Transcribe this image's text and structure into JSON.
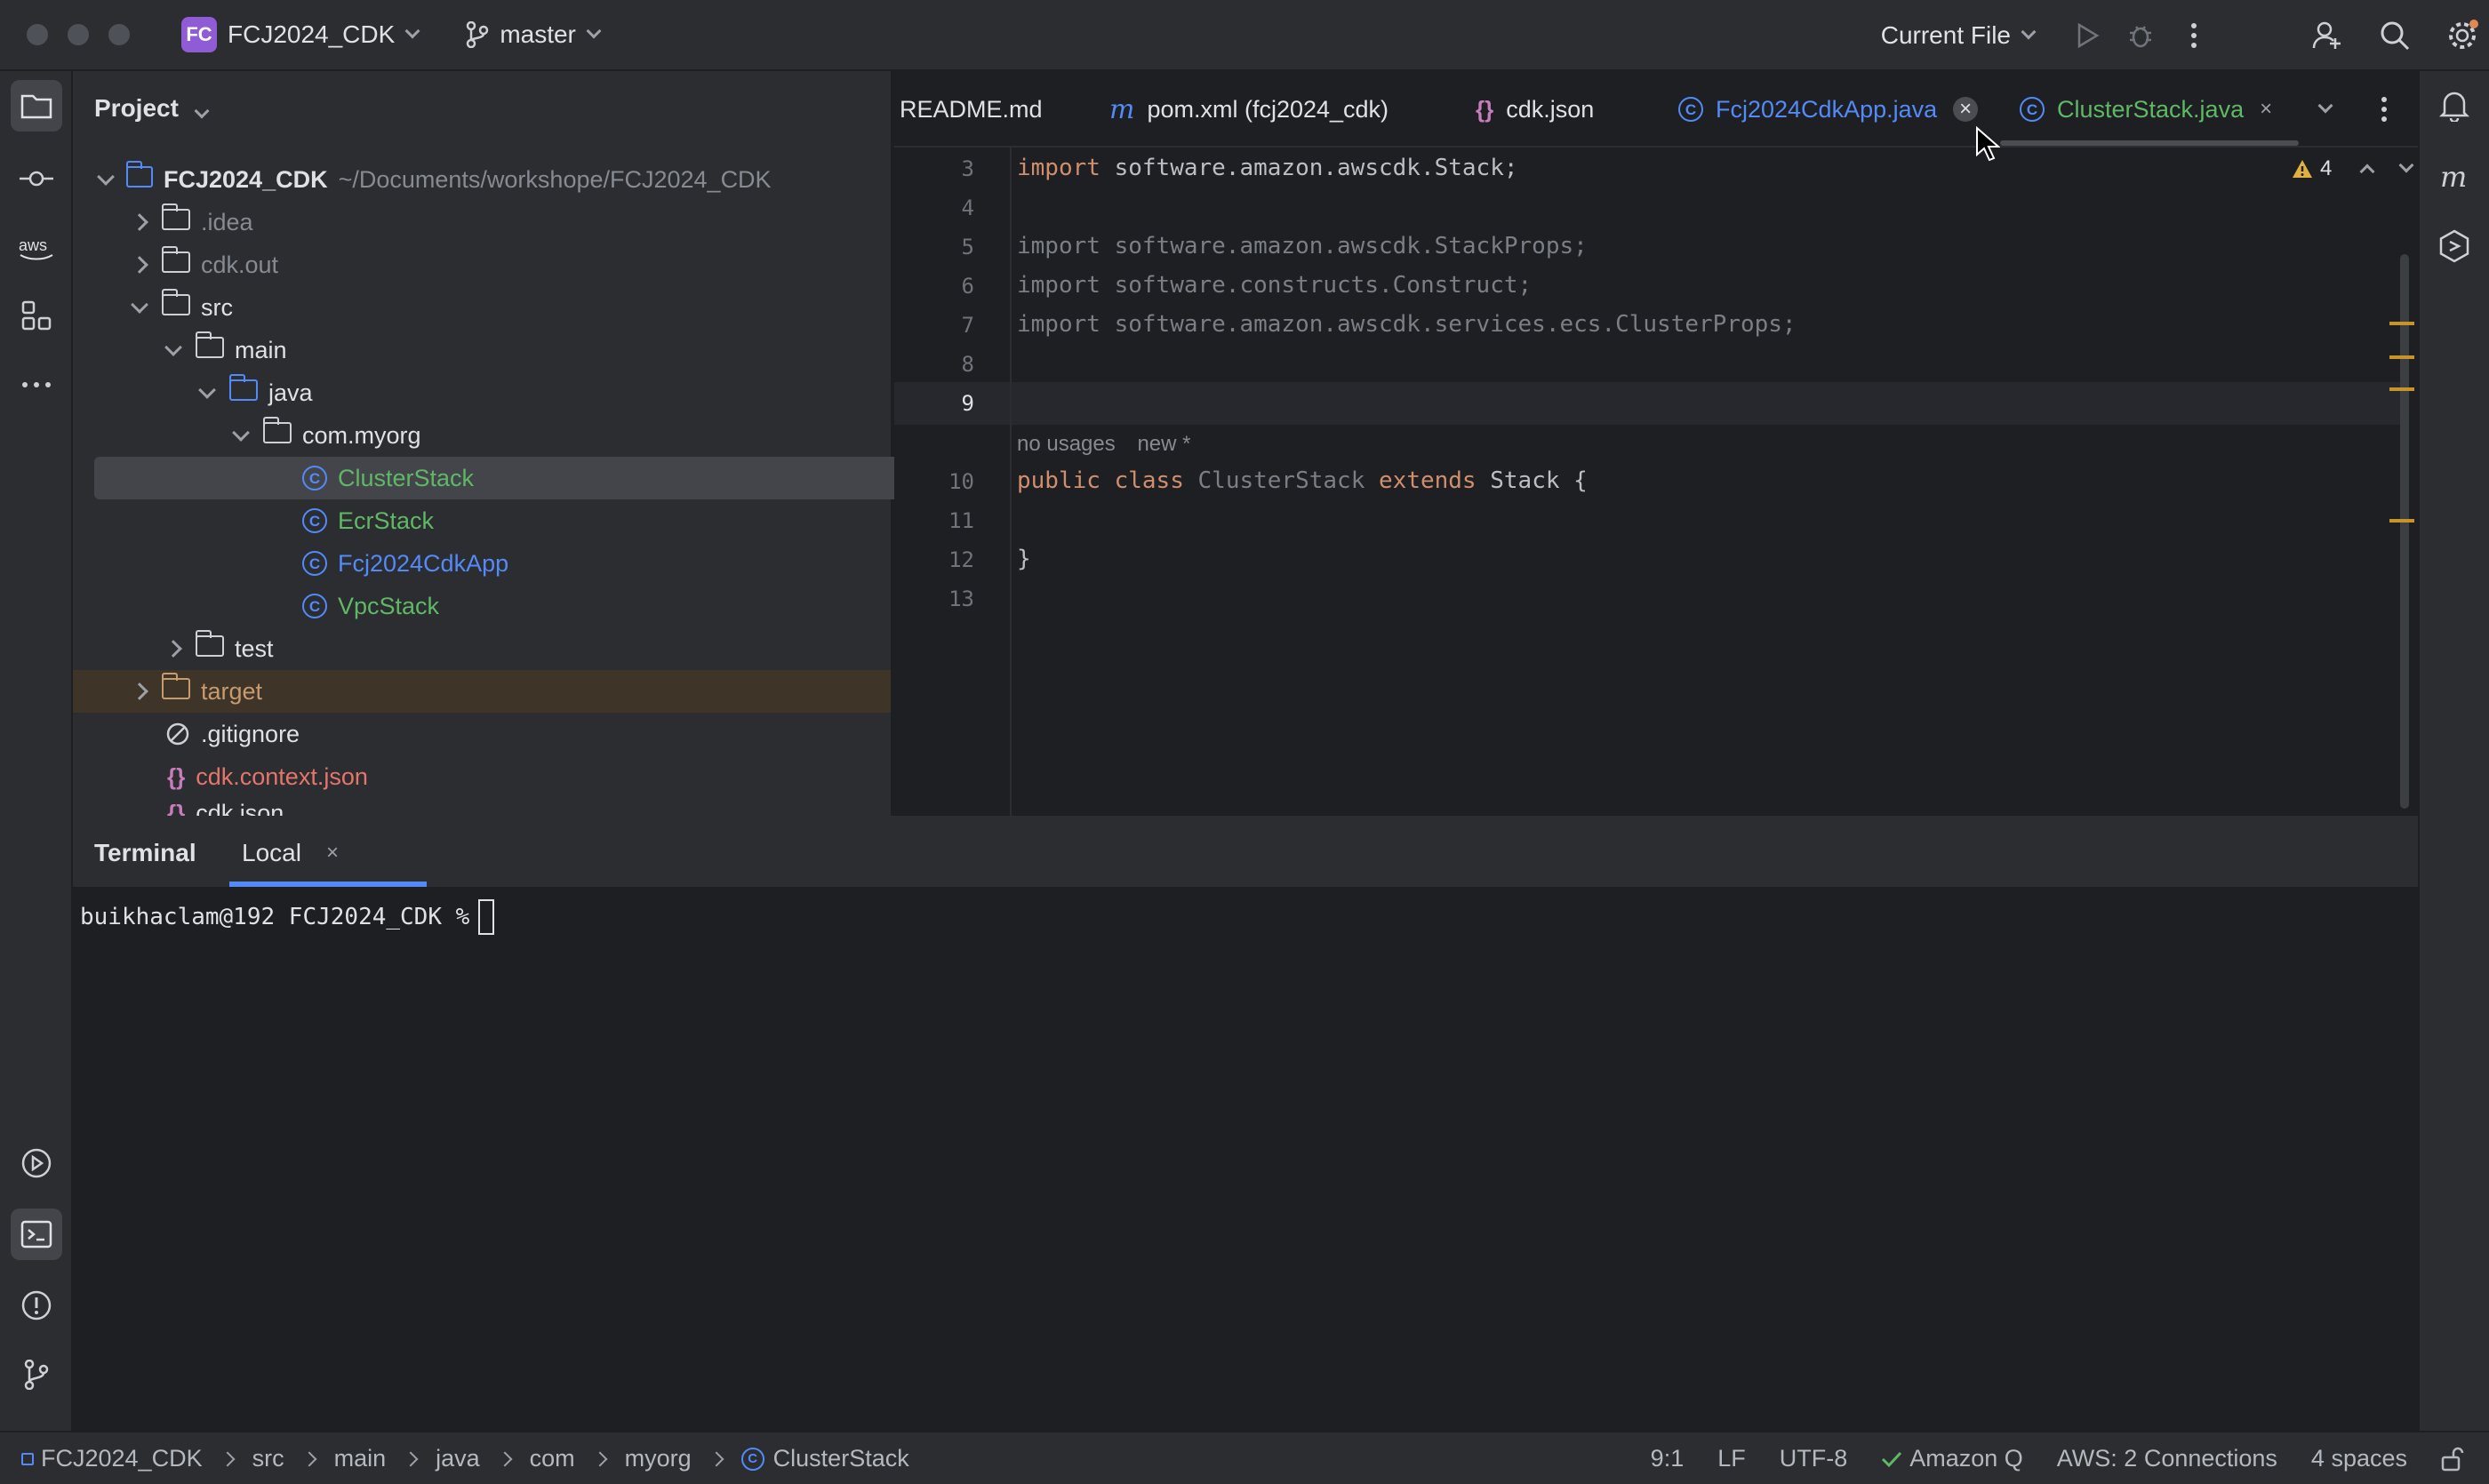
{
  "titlebar": {
    "project_badge": "FC",
    "project_name": "FCJ2024_CDK",
    "branch": "master",
    "run_config": "Current File"
  },
  "project_panel": {
    "title": "Project",
    "root_name": "FCJ2024_CDK",
    "root_path": "~/Documents/workshope/FCJ2024_CDK",
    "items": [
      {
        "label": ".idea"
      },
      {
        "label": "cdk.out"
      },
      {
        "label": "src"
      },
      {
        "label": "main"
      },
      {
        "label": "java"
      },
      {
        "label": "com.myorg"
      },
      {
        "label": "ClusterStack"
      },
      {
        "label": "EcrStack"
      },
      {
        "label": "Fcj2024CdkApp"
      },
      {
        "label": "VpcStack"
      },
      {
        "label": "test"
      },
      {
        "label": "target"
      },
      {
        "label": ".gitignore"
      },
      {
        "label": "cdk.context.json"
      },
      {
        "label": "cdk.json"
      }
    ]
  },
  "tabs": [
    {
      "label": "README.md"
    },
    {
      "label": "pom.xml (fcj2024_cdk)"
    },
    {
      "label": "cdk.json"
    },
    {
      "label": "Fcj2024CdkApp.java"
    },
    {
      "label": "ClusterStack.java"
    }
  ],
  "editor": {
    "warning_count": "4",
    "line_numbers": [
      "3",
      "4",
      "5",
      "6",
      "7",
      "8",
      "9",
      "10",
      "11",
      "12",
      "13"
    ],
    "lines": {
      "l3_kw": "import",
      "l3_rest": " software.amazon.awscdk.Stack;",
      "l5_kw": "import",
      "l5_rest": " software.amazon.awscdk.StackProps;",
      "l6_kw": "import",
      "l6_rest": " software.constructs.Construct;",
      "l7_kw": "import",
      "l7_rest": " software.amazon.awscdk.services.ecs.ClusterProps;",
      "hint_usages": "no usages",
      "hint_new": "new *",
      "l10_public": "public",
      "l10_class": "class",
      "l10_name": "ClusterStack",
      "l10_extends": "extends",
      "l10_rest": "Stack {",
      "l12": "}"
    }
  },
  "terminal": {
    "title": "Terminal",
    "tab": "Local",
    "prompt": "buikhaclam@192 FCJ2024_CDK %"
  },
  "statusbar": {
    "breadcrumbs": [
      "FCJ2024_CDK",
      "src",
      "main",
      "java",
      "com",
      "myorg",
      "ClusterStack"
    ],
    "position": "9:1",
    "line_sep": "LF",
    "encoding": "UTF-8",
    "amazon_q": "Amazon Q",
    "aws": "AWS: 2 Connections",
    "indent": "4 spaces"
  },
  "colors": {
    "accent_blue": "#548af7",
    "badge_purple": "#8f5cd6",
    "keyword_orange": "#cf8e6d",
    "green_file": "#5fb865",
    "orange_file": "#c69b6d",
    "red_file": "#e5756b"
  }
}
